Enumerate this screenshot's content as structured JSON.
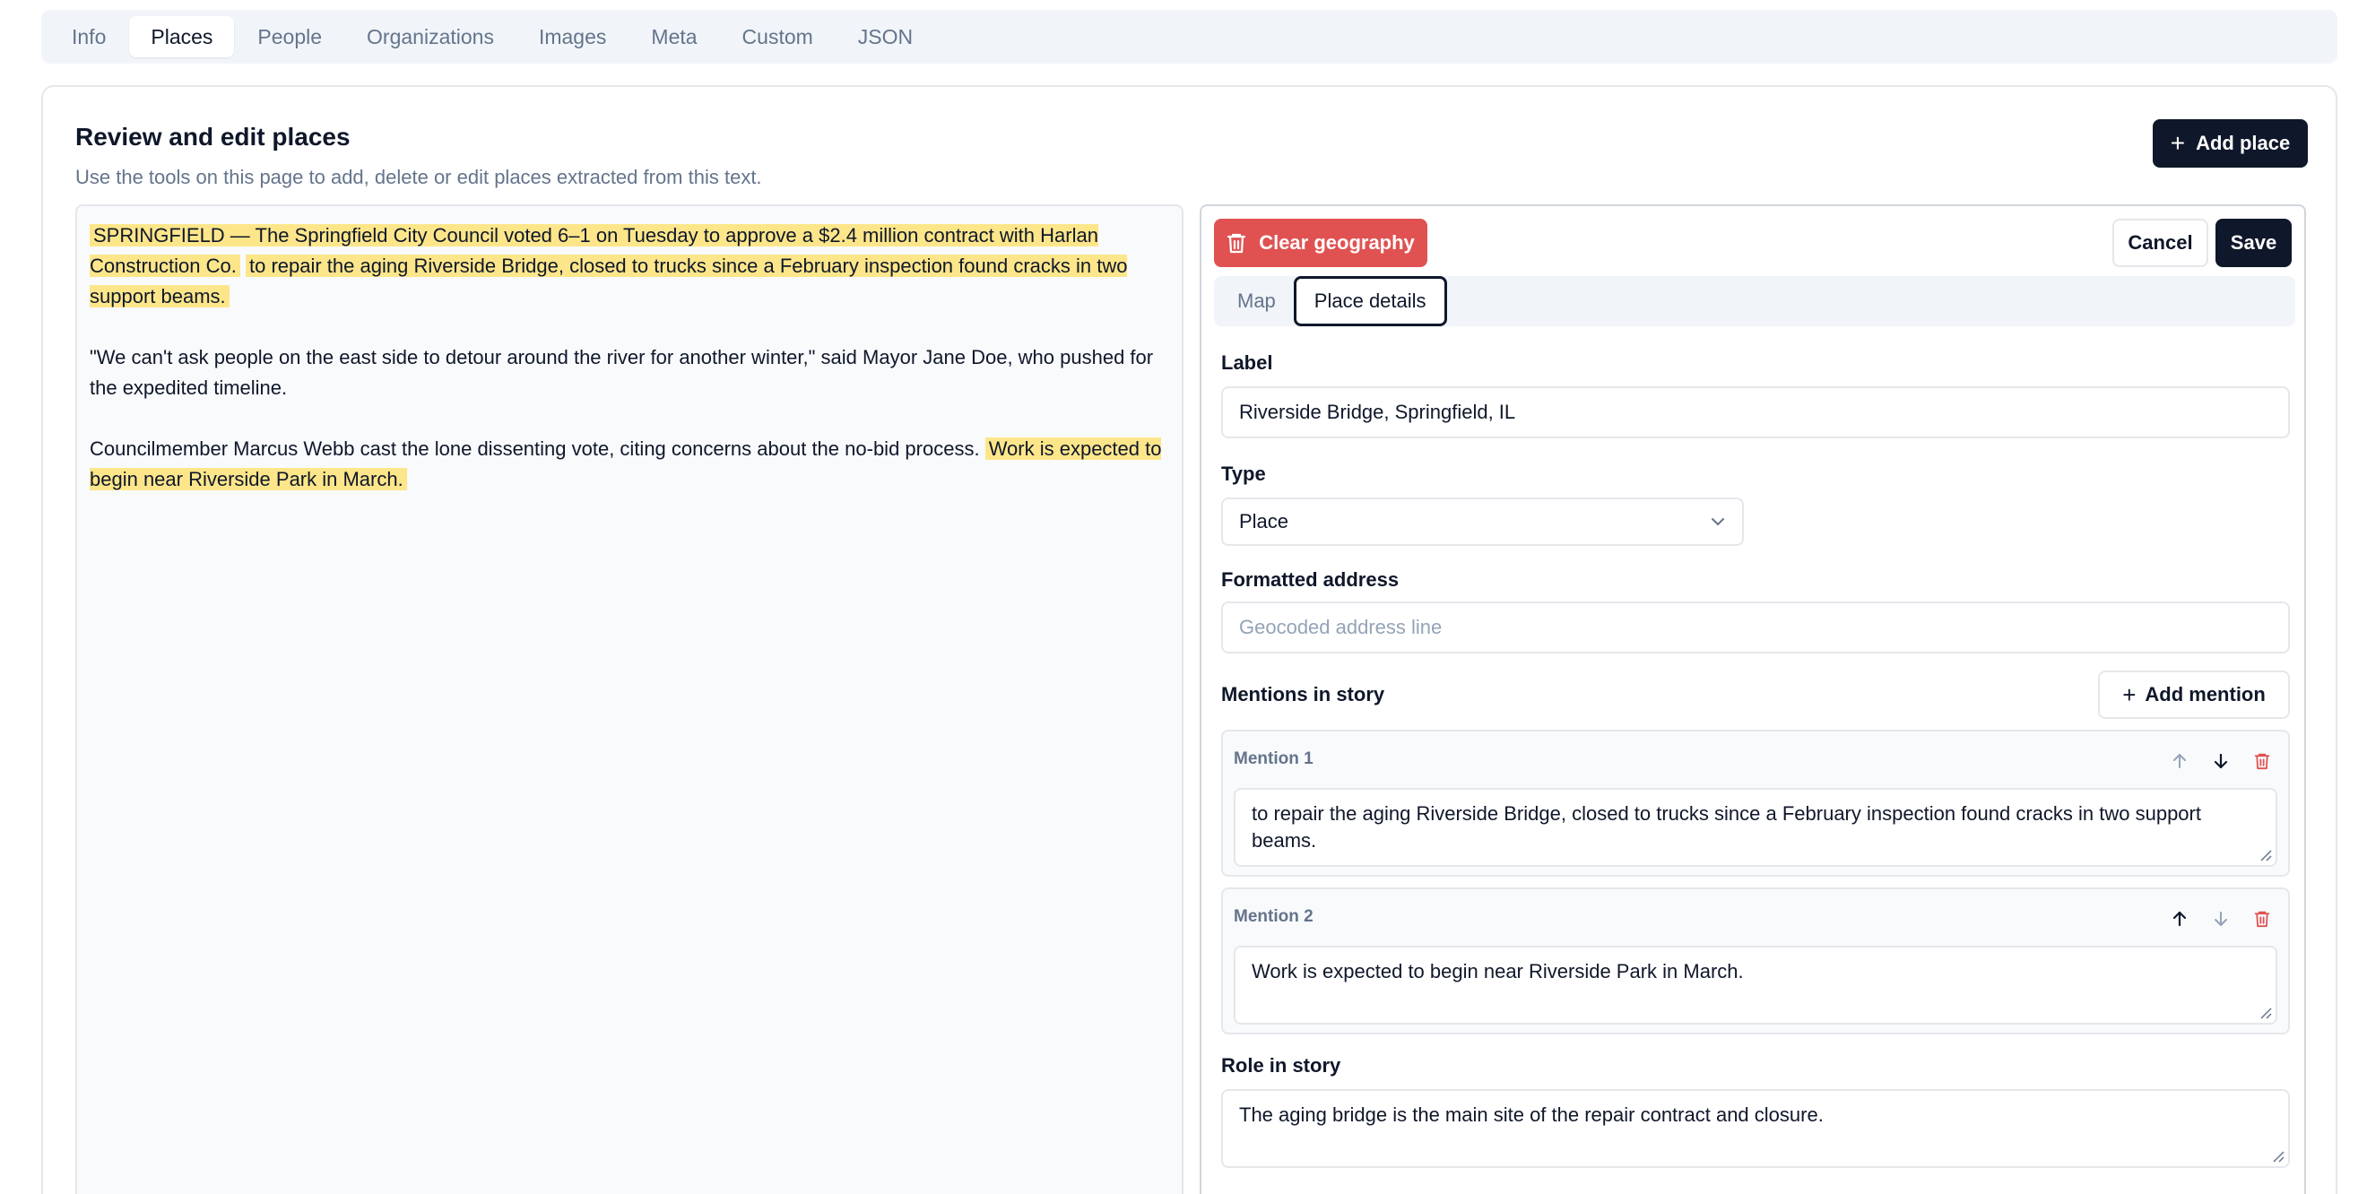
{
  "tabs": [
    "Info",
    "Places",
    "People",
    "Organizations",
    "Images",
    "Meta",
    "Custom",
    "JSON"
  ],
  "active_tab": "Places",
  "card": {
    "title": "Review and edit places",
    "description": "Use the tools on this page to add, delete or edit places extracted from this text.",
    "add_place_label": "Add place"
  },
  "story": {
    "p1_a": "SPRINGFIELD — The Springfield City Council voted 6–1 on Tuesday to approve a $2.4 million contract with Harlan Construction Co.",
    "p1_b": "to repair the aging Riverside Bridge, closed to trucks since a February inspection found cracks in two support beams.",
    "p2": "\"We can't ask people on the east side to detour around the river for another winter,\" said Mayor Jane Doe, who pushed for the expedited timeline.",
    "p3_a": "Councilmember Marcus Webb cast the lone dissenting vote, citing concerns about the no-bid process.",
    "p3_b": "Work is expected to begin near Riverside Park in March."
  },
  "editor": {
    "clear_geography_label": "Clear geography",
    "cancel_label": "Cancel",
    "save_label": "Save",
    "subtabs": [
      "Map",
      "Place details"
    ],
    "active_subtab": "Place details",
    "label_heading": "Label",
    "label_value": "Riverside Bridge, Springfield, IL",
    "type_heading": "Type",
    "type_value": "Place",
    "address_heading": "Formatted address",
    "address_placeholder": "Geocoded address line",
    "mentions_heading": "Mentions in story",
    "add_mention_label": "Add mention",
    "mentions": [
      {
        "title": "Mention 1",
        "text": "to repair the aging Riverside Bridge, closed to trucks since a February inspection found cracks in two support beams."
      },
      {
        "title": "Mention 2",
        "text": "Work is expected to begin near Riverside Park in March."
      }
    ],
    "role_heading": "Role in story",
    "role_value": "The aging bridge is the main site of the repair contract and closure."
  },
  "colors": {
    "accent_dark": "#0f172a",
    "danger": "#e05252",
    "highlight": "#fde68a"
  }
}
